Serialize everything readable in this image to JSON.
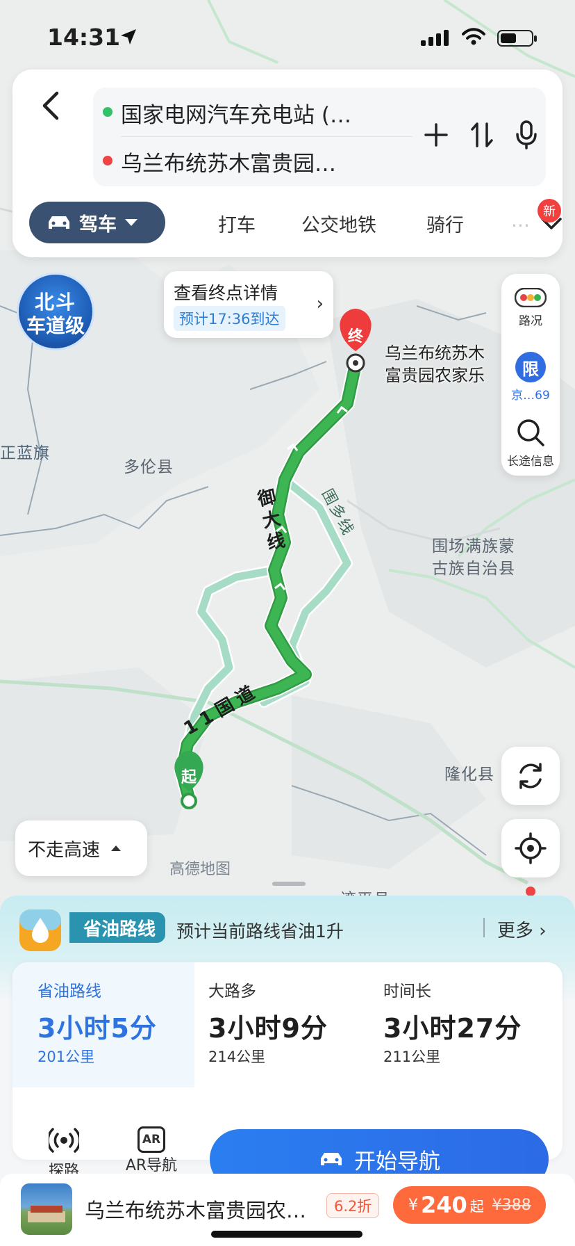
{
  "status_bar": {
    "time": "14:31"
  },
  "search": {
    "origin": "国家电网汽车充电站 (…",
    "destination": "乌兰布统苏木富贵园…"
  },
  "tabs": [
    {
      "label": "驾车"
    },
    {
      "label": "打车"
    },
    {
      "label": "公交地铁"
    },
    {
      "label": "骑行"
    },
    {
      "label": "…"
    }
  ],
  "new_badge": "新",
  "beidou": {
    "line1": "北斗",
    "line2": "车道级"
  },
  "destination_tip": {
    "title": "查看终点详情",
    "eta": "预计17:36到达"
  },
  "destination_marker": "终",
  "origin_marker": "起",
  "destination_name": "乌兰布统苏木\n富贵园农家乐",
  "map_labels": {
    "zhenglan": "正蓝旗",
    "duolun": "多伦县",
    "weichang": "围场满族蒙\n古族自治县",
    "longhua": "隆化县",
    "gaode": "高德地图",
    "luanping": "滦平县"
  },
  "route_labels": {
    "yuda": "御大线",
    "guodao": "11国道",
    "weiduo": "围多线"
  },
  "right_tools": {
    "traffic": "路况",
    "limit_icon": "限",
    "limit": "京…69",
    "long_trip": "长途信息"
  },
  "no_highway": "不走高速",
  "eco": {
    "tag": "省油路线",
    "text": "预计当前路线省油1升",
    "more": "更多"
  },
  "routes": [
    {
      "name": "省油路线",
      "time": "3小时5分",
      "distance": "201公里"
    },
    {
      "name": "大路多",
      "time": "3小时9分",
      "distance": "214公里"
    },
    {
      "name": "时间长",
      "time": "3小时27分",
      "distance": "211公里"
    }
  ],
  "tools": {
    "explore": "探路",
    "ar_icon": "AR",
    "ar": "AR导航"
  },
  "start_nav": "开始导航",
  "hotel": {
    "name": "乌兰布统苏木富贵园农…",
    "discount": "6.2折",
    "currency": "¥",
    "price": "240",
    "price_suffix": "起",
    "old_price": "¥388"
  },
  "colors": {
    "route_main": "#3db553",
    "route_alt": "#a6dcc6",
    "accent_blue": "#2f73e0",
    "tab_active": "#3a5172",
    "price": "#ff6a3d"
  }
}
